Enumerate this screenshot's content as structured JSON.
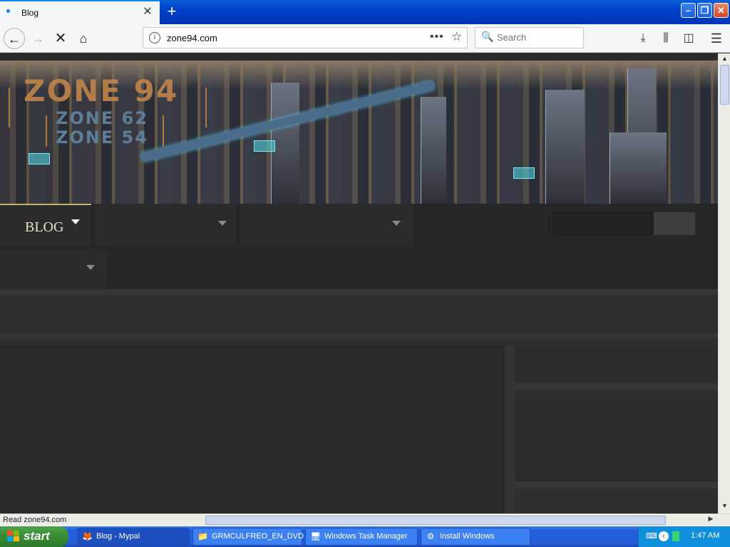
{
  "browser": {
    "tab": {
      "title": "Blog"
    },
    "new_tab_symbol": "+",
    "url": "zone94.com",
    "search_placeholder": "Search",
    "icons": [
      "back-icon",
      "forward-icon",
      "stop-icon",
      "home-icon",
      "info-icon",
      "page-actions-icon",
      "bookmark-star-icon",
      "download-icon",
      "library-icon",
      "sidebar-icon",
      "menu-icon"
    ]
  },
  "site": {
    "logo_main": "ZONE 94",
    "logo_sub1": "ZONE 62",
    "logo_sub2": "ZONE 54",
    "menu": {
      "blog_label": "BLOG"
    }
  },
  "status": {
    "text": "Read zone94.com"
  },
  "taskbar": {
    "start_label": "start",
    "tasks": [
      {
        "label": "Blog - Mypal",
        "icon": "browser-icon"
      },
      {
        "label": "GRMCULFREO_EN_DVD",
        "icon": "folder-icon"
      },
      {
        "label": "Windows Task Manager",
        "icon": "task-manager-icon"
      },
      {
        "label": "Install Windows",
        "icon": "installer-icon"
      }
    ],
    "clock": "1:47 AM"
  },
  "colors": {
    "titlebar": "#0040c8",
    "accent_gold": "#c7b06b",
    "page_bg": "#2e2e2e",
    "logo_orange": "#c8894a",
    "logo_steel": "#5d7d98"
  }
}
